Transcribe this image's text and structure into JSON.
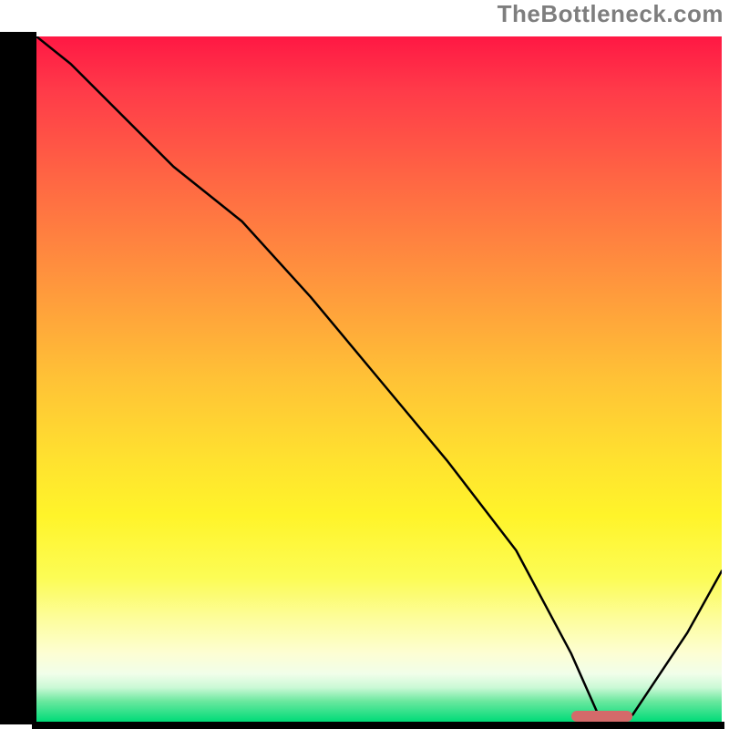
{
  "watermark": "TheBottleneck.com",
  "chart_data": {
    "type": "line",
    "title": "",
    "xlabel": "",
    "ylabel": "",
    "xlim": [
      0,
      100
    ],
    "ylim": [
      0,
      100
    ],
    "x": [
      0,
      5,
      20,
      30,
      40,
      50,
      60,
      70,
      78,
      82,
      87,
      95,
      100
    ],
    "values": [
      100,
      96,
      81,
      73,
      62,
      50,
      38,
      25,
      10,
      1,
      1,
      13,
      22
    ],
    "marker": {
      "x_start": 78,
      "x_end": 87,
      "y": 0.8
    },
    "background_gradient_note": "vertical rainbow red→yellow→green indicating score/bottleneck severity"
  }
}
